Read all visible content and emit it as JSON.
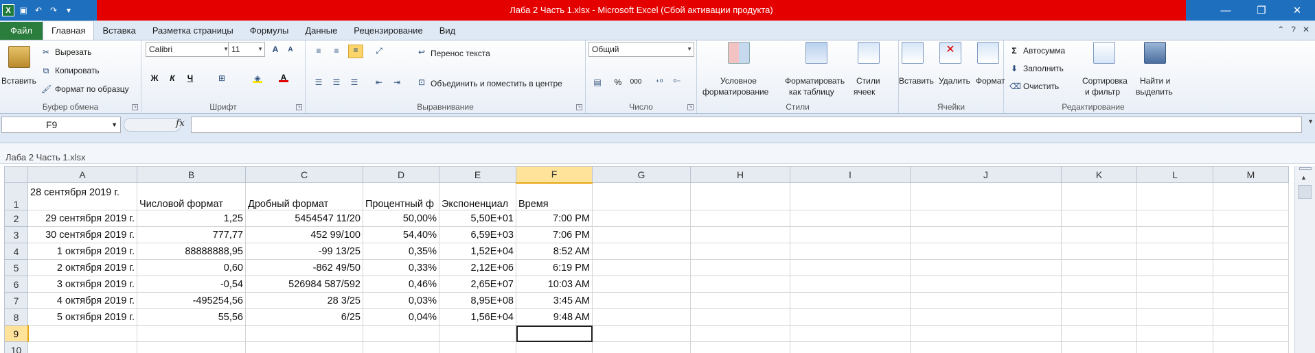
{
  "app": {
    "title": "Лаба 2 Часть 1.xlsx  -  Microsoft Excel (Сбой активации продукта)",
    "workbook_title": "Лаба 2 Часть 1.xlsx"
  },
  "tabs": [
    "Файл",
    "Главная",
    "Вставка",
    "Разметка страницы",
    "Формулы",
    "Данные",
    "Рецензирование",
    "Вид"
  ],
  "ribbon": {
    "clipboard": {
      "label": "Буфер обмена",
      "paste": "Вставить",
      "cut": "Вырезать",
      "copy": "Копировать",
      "format_painter": "Формат по образцу"
    },
    "font": {
      "label": "Шрифт",
      "family": "Calibri",
      "size": "11",
      "bold": "Ж",
      "italic": "К",
      "underline": "Ч"
    },
    "alignment": {
      "label": "Выравнивание",
      "wrap": "Перенос текста",
      "merge": "Объединить и поместить в центре"
    },
    "number": {
      "label": "Число",
      "format": "Общий",
      "percent": "%",
      "thousands": "000"
    },
    "styles": {
      "label": "Стили",
      "conditional": "Условное",
      "conditional2": "форматирование",
      "as_table": "Форматировать",
      "as_table2": "как таблицу",
      "cell_styles": "Стили",
      "cell_styles2": "ячеек"
    },
    "cells": {
      "label": "Ячейки",
      "insert": "Вставить",
      "delete": "Удалить",
      "format": "Формат"
    },
    "editing": {
      "label": "Редактирование",
      "autosum": "Автосумма",
      "fill": "Заполнить",
      "clear": "Очистить",
      "sort": "Сортировка",
      "sort2": "и фильтр",
      "find": "Найти и",
      "find2": "выделить"
    }
  },
  "formula_bar": {
    "name_box": "F9",
    "fx": "fx",
    "formula": ""
  },
  "sheet": {
    "columns": [
      "A",
      "B",
      "C",
      "D",
      "E",
      "F",
      "G",
      "H",
      "I",
      "J",
      "K",
      "L",
      "M"
    ],
    "rows": [
      {
        "n": "1",
        "A": "28 сентября 2019 г.",
        "B": "Числовой формат",
        "C": "Дробный формат",
        "D": "Процентный ф",
        "E": "Экспоненциал",
        "F": "Время"
      },
      {
        "n": "2",
        "A": "29 сентября 2019 г.",
        "B": "1,25",
        "C": "5454547   11/20",
        "D": "50,00%",
        "E": "5,50E+01",
        "F": "7:00 PM"
      },
      {
        "n": "3",
        "A": "30 сентября 2019 г.",
        "B": "777,77",
        "C": "452   99/100",
        "D": "54,40%",
        "E": "6,59E+03",
        "F": "7:06 PM"
      },
      {
        "n": "4",
        "A": "1 октября 2019 г.",
        "B": "88888888,95",
        "C": "-99   13/25",
        "D": "0,35%",
        "E": "1,52E+04",
        "F": "8:52 AM"
      },
      {
        "n": "5",
        "A": "2 октября 2019 г.",
        "B": "0,60",
        "C": "-862   49/50",
        "D": "0,33%",
        "E": "2,12E+06",
        "F": "6:19 PM"
      },
      {
        "n": "6",
        "A": "3 октября 2019 г.",
        "B": "-0,54",
        "C": "526984 587/592",
        "D": "0,46%",
        "E": "2,65E+07",
        "F": "10:03 AM"
      },
      {
        "n": "7",
        "A": "4 октября 2019 г.",
        "B": "-495254,56",
        "C": "28    3/25",
        "D": "0,03%",
        "E": "8,95E+08",
        "F": "3:45 AM"
      },
      {
        "n": "8",
        "A": "5 октября 2019 г.",
        "B": "55,56",
        "C": "6/25",
        "D": "0,04%",
        "E": "1,56E+04",
        "F": "9:48 AM"
      },
      {
        "n": "9",
        "A": "",
        "B": "",
        "C": "",
        "D": "",
        "E": "",
        "F": ""
      },
      {
        "n": "10",
        "A": "",
        "B": "",
        "C": "",
        "D": "",
        "E": "",
        "F": ""
      }
    ],
    "active_cell": "F9"
  }
}
